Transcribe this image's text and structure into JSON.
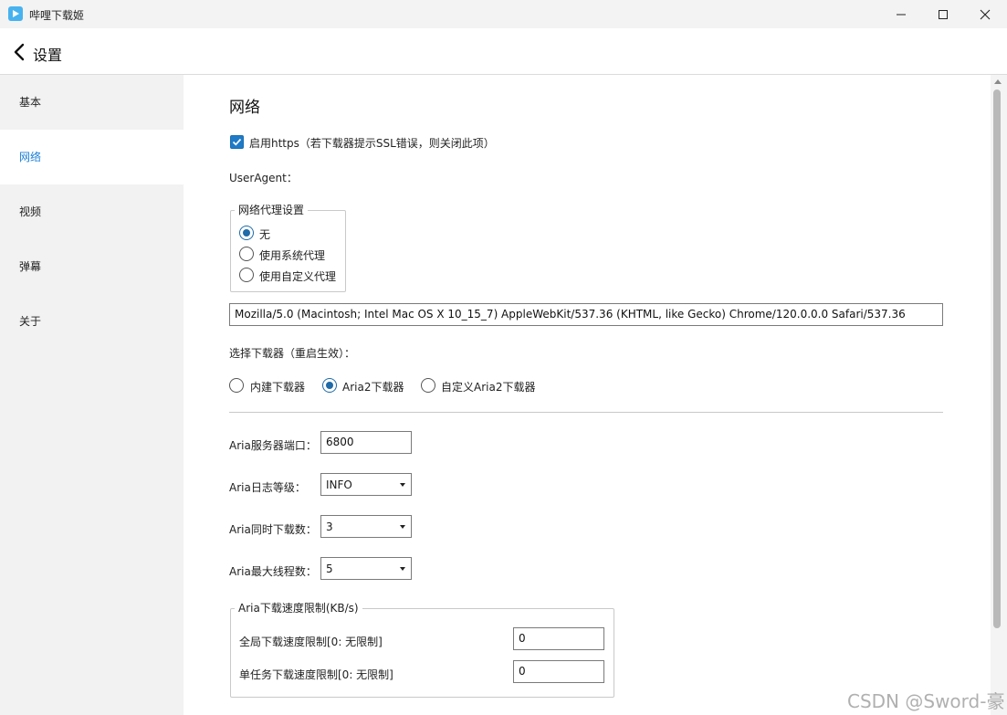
{
  "window": {
    "title": "哔哩下载姬",
    "minimize_icon": "minimize-icon",
    "maximize_icon": "maximize-icon",
    "close_icon": "close-icon"
  },
  "header": {
    "back_icon": "chevron-left-icon",
    "title": "设置"
  },
  "sidebar": {
    "items": [
      {
        "label": "基本"
      },
      {
        "label": "网络",
        "active": true
      },
      {
        "label": "视频"
      },
      {
        "label": "弹幕"
      },
      {
        "label": "关于"
      }
    ]
  },
  "main": {
    "section_title": "网络",
    "https_checkbox": {
      "label": "启用https（若下载器提示SSL错误，则关闭此项）",
      "checked": true
    },
    "useragent_label": "UserAgent：",
    "proxy_group": {
      "title": "网络代理设置",
      "options": [
        {
          "label": "无",
          "selected": true
        },
        {
          "label": "使用系统代理",
          "selected": false
        },
        {
          "label": "使用自定义代理",
          "selected": false
        }
      ]
    },
    "useragent_value": "Mozilla/5.0 (Macintosh; Intel Mac OS X 10_15_7) AppleWebKit/537.36 (KHTML, like Gecko) Chrome/120.0.0.0 Safari/537.36",
    "downloader_label": "选择下载器（重启生效）：",
    "downloader_options": [
      {
        "label": "内建下载器",
        "selected": false
      },
      {
        "label": "Aria2下载器",
        "selected": true
      },
      {
        "label": "自定义Aria2下载器",
        "selected": false
      }
    ],
    "aria_port": {
      "label": "Aria服务器端口：",
      "value": "6800"
    },
    "aria_log_level": {
      "label": "Aria日志等级：",
      "value": "INFO"
    },
    "aria_concurrent": {
      "label": "Aria同时下载数：",
      "value": "3"
    },
    "aria_max_threads": {
      "label": "Aria最大线程数：",
      "value": "5"
    },
    "speed_group": {
      "title": "Aria下载速度限制(KB/s)",
      "global_label": "全局下载速度限制[0: 无限制]",
      "global_value": "0",
      "task_label": "单任务下载速度限制[0: 无限制]",
      "task_value": "0"
    }
  },
  "colors": {
    "accent": "#1f6aa8",
    "active_nav": "#1a7fd9",
    "sidebar_bg": "#f2f2f2",
    "app_logo": "#48b2ef"
  },
  "watermark": "CSDN @Sword-豪"
}
